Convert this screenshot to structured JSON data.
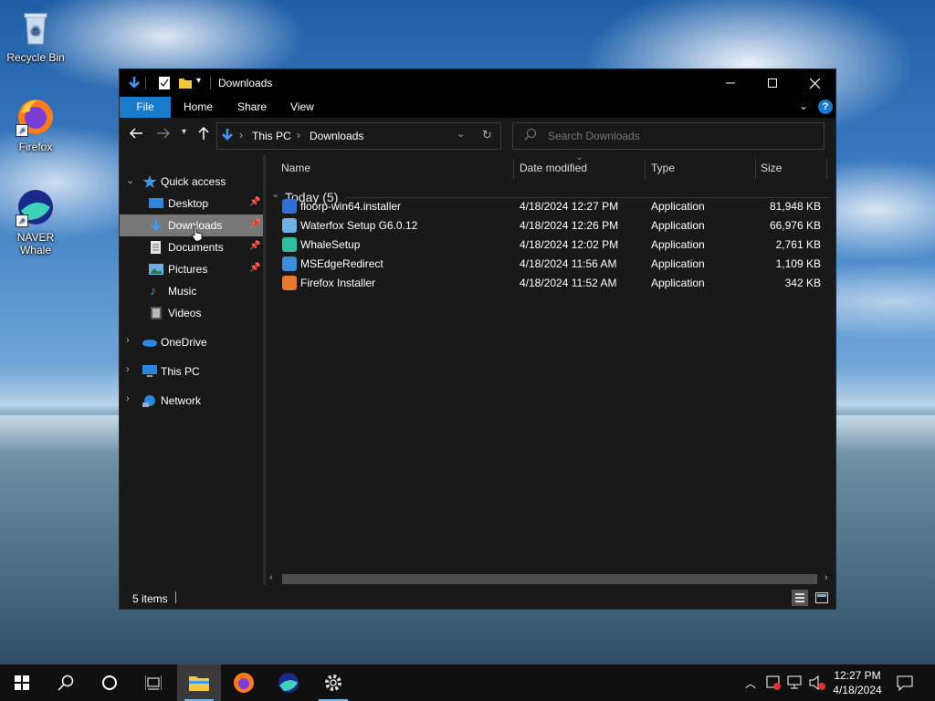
{
  "desktop": {
    "icons": [
      {
        "label": "Recycle Bin"
      },
      {
        "label": "Firefox"
      },
      {
        "label": "NAVER Whale"
      }
    ]
  },
  "window": {
    "title": "Downloads",
    "ribbon_tabs": [
      "File",
      "Home",
      "Share",
      "View"
    ],
    "address": {
      "segments": [
        "This PC",
        "Downloads"
      ]
    },
    "search_placeholder": "Search Downloads",
    "nav_pane": {
      "quick_access": "Quick access",
      "items": [
        {
          "label": "Desktop",
          "pinned": true
        },
        {
          "label": "Downloads",
          "pinned": true,
          "selected": true
        },
        {
          "label": "Documents",
          "pinned": true
        },
        {
          "label": "Pictures",
          "pinned": true
        },
        {
          "label": "Music",
          "pinned": false
        },
        {
          "label": "Videos",
          "pinned": false
        }
      ],
      "roots": [
        "OneDrive",
        "This PC",
        "Network"
      ]
    },
    "columns": [
      "Name",
      "Date modified",
      "Type",
      "Size"
    ],
    "group": "Today (5)",
    "files": [
      {
        "name": "floorp-win64.installer",
        "date": "4/18/2024 12:27 PM",
        "type": "Application",
        "size": "81,948 KB",
        "icon_color": "#2f6fd6"
      },
      {
        "name": "Waterfox Setup G6.0.12",
        "date": "4/18/2024 12:26 PM",
        "type": "Application",
        "size": "66,976 KB",
        "icon_color": "#6cb4e6"
      },
      {
        "name": "WhaleSetup",
        "date": "4/18/2024 12:02 PM",
        "type": "Application",
        "size": "2,761 KB",
        "icon_color": "#2fbfa0"
      },
      {
        "name": "MSEdgeRedirect",
        "date": "4/18/2024 11:56 AM",
        "type": "Application",
        "size": "1,109 KB",
        "icon_color": "#3a8fd8"
      },
      {
        "name": "Firefox Installer",
        "date": "4/18/2024 11:52 AM",
        "type": "Application",
        "size": "342 KB",
        "icon_color": "#e8762b"
      }
    ],
    "status": "5 items"
  },
  "taskbar": {
    "time": "12:27 PM",
    "date": "4/18/2024"
  }
}
